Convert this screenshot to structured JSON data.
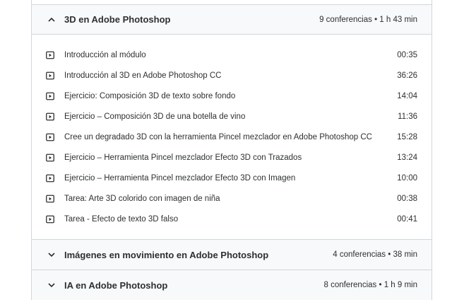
{
  "sections": [
    {
      "title": "3D en Adobe Photoshop",
      "meta": "9 conferencias • 1 h 43 min",
      "expanded": true,
      "icon": "chevron-up-icon"
    },
    {
      "title": "Imágenes en movimiento en Adobe Photoshop",
      "meta": "4 conferencias • 38 min",
      "expanded": false,
      "icon": "chevron-down-icon"
    },
    {
      "title": "IA en Adobe Photoshop",
      "meta": "8 conferencias • 1 h 9 min",
      "expanded": false,
      "icon": "chevron-down-icon"
    }
  ],
  "lectures": [
    {
      "title": "Introducción al módulo",
      "duration": "00:35",
      "icon": "video-play-icon"
    },
    {
      "title": "Introducción al 3D en Adobe Photoshop CC",
      "duration": "36:26",
      "icon": "video-play-icon"
    },
    {
      "title": "Ejercicio: Composición 3D de texto sobre fondo",
      "duration": "14:04",
      "icon": "video-play-icon"
    },
    {
      "title": "Ejercicio – Composición 3D de una botella de vino",
      "duration": "11:36",
      "icon": "video-play-icon"
    },
    {
      "title": "Cree un degradado 3D con la herramienta Pincel mezclador en Adobe Photoshop CC",
      "duration": "15:28",
      "icon": "video-play-icon"
    },
    {
      "title": "Ejercicio – Herramienta Pincel mezclador Efecto 3D con Trazados",
      "duration": "13:24",
      "icon": "video-play-icon"
    },
    {
      "title": "Ejercicio – Herramienta Pincel mezclador Efecto 3D con Imagen",
      "duration": "10:00",
      "icon": "video-play-icon"
    },
    {
      "title": "Tarea: Arte 3D colorido con imagen de niña",
      "duration": "00:38",
      "icon": "video-play-icon"
    },
    {
      "title": "Tarea - Efecto de texto 3D falso",
      "duration": "00:41",
      "icon": "video-play-icon"
    }
  ]
}
